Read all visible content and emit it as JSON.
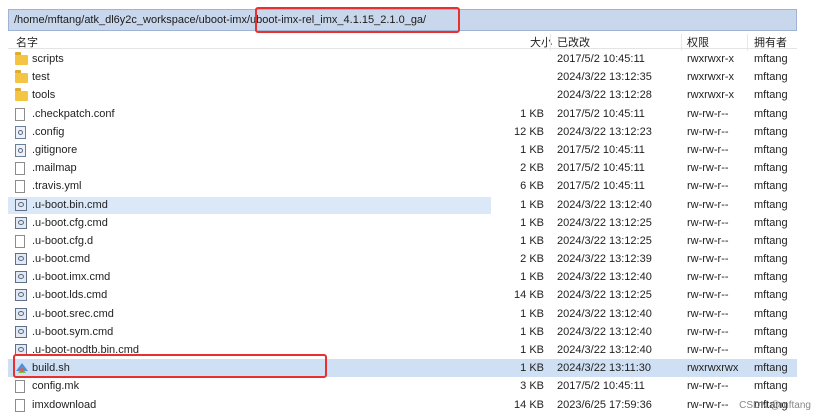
{
  "path": "/home/mftang/atk_dl6y2c_workspace/uboot-imx/uboot-imx-rel_imx_4.1.15_2.1.0_ga/",
  "columns": {
    "name": "名字",
    "size": "大小",
    "date": "已改改",
    "perm": "权限",
    "owner": "拥有者"
  },
  "rows": [
    {
      "name": "scripts",
      "size": "",
      "date": "2017/5/2 10:45:11",
      "perm": "rwxrwxr-x",
      "owner": "mftang",
      "icon": "folder-icon"
    },
    {
      "name": "test",
      "size": "",
      "date": "2024/3/22 13:12:35",
      "perm": "rwxrwxr-x",
      "owner": "mftang",
      "icon": "folder-icon"
    },
    {
      "name": "tools",
      "size": "",
      "date": "2024/3/22 13:12:28",
      "perm": "rwxrwxr-x",
      "owner": "mftang",
      "icon": "folder-icon"
    },
    {
      "name": ".checkpatch.conf",
      "size": "1 KB",
      "date": "2017/5/2 10:45:11",
      "perm": "rw-rw-r--",
      "owner": "mftang",
      "icon": "file-icon"
    },
    {
      "name": ".config",
      "size": "12 KB",
      "date": "2024/3/22 13:12:23",
      "perm": "rw-rw-r--",
      "owner": "mftang",
      "icon": "config-file-icon"
    },
    {
      "name": ".gitignore",
      "size": "1 KB",
      "date": "2017/5/2 10:45:11",
      "perm": "rw-rw-r--",
      "owner": "mftang",
      "icon": "config-file-icon"
    },
    {
      "name": ".mailmap",
      "size": "2 KB",
      "date": "2017/5/2 10:45:11",
      "perm": "rw-rw-r--",
      "owner": "mftang",
      "icon": "file-icon"
    },
    {
      "name": ".travis.yml",
      "size": "6 KB",
      "date": "2017/5/2 10:45:11",
      "perm": "rw-rw-r--",
      "owner": "mftang",
      "icon": "yml-file-icon"
    },
    {
      "name": ".u-boot.bin.cmd",
      "size": "1 KB",
      "date": "2024/3/22 13:12:40",
      "perm": "rw-rw-r--",
      "owner": "mftang",
      "icon": "cmd-file-icon",
      "highlight": "blue"
    },
    {
      "name": ".u-boot.cfg.cmd",
      "size": "1 KB",
      "date": "2024/3/22 13:12:25",
      "perm": "rw-rw-r--",
      "owner": "mftang",
      "icon": "cmd-file-icon"
    },
    {
      "name": ".u-boot.cfg.d",
      "size": "1 KB",
      "date": "2024/3/22 13:12:25",
      "perm": "rw-rw-r--",
      "owner": "mftang",
      "icon": "file-icon"
    },
    {
      "name": ".u-boot.cmd",
      "size": "2 KB",
      "date": "2024/3/22 13:12:39",
      "perm": "rw-rw-r--",
      "owner": "mftang",
      "icon": "cmd-file-icon"
    },
    {
      "name": ".u-boot.imx.cmd",
      "size": "1 KB",
      "date": "2024/3/22 13:12:40",
      "perm": "rw-rw-r--",
      "owner": "mftang",
      "icon": "cmd-file-icon"
    },
    {
      "name": ".u-boot.lds.cmd",
      "size": "14 KB",
      "date": "2024/3/22 13:12:25",
      "perm": "rw-rw-r--",
      "owner": "mftang",
      "icon": "cmd-file-icon"
    },
    {
      "name": ".u-boot.srec.cmd",
      "size": "1 KB",
      "date": "2024/3/22 13:12:40",
      "perm": "rw-rw-r--",
      "owner": "mftang",
      "icon": "cmd-file-icon"
    },
    {
      "name": ".u-boot.sym.cmd",
      "size": "1 KB",
      "date": "2024/3/22 13:12:40",
      "perm": "rw-rw-r--",
      "owner": "mftang",
      "icon": "cmd-file-icon"
    },
    {
      "name": ".u-boot-nodtb.bin.cmd",
      "size": "1 KB",
      "date": "2024/3/22 13:12:40",
      "perm": "rw-rw-r--",
      "owner": "mftang",
      "icon": "cmd-file-icon"
    },
    {
      "name": "build.sh",
      "size": "1 KB",
      "date": "2024/3/22 13:11:30",
      "perm": "rwxrwxrwx",
      "owner": "mftang",
      "icon": "shell-script-icon",
      "highlight": "strong"
    },
    {
      "name": "config.mk",
      "size": "3 KB",
      "date": "2017/5/2 10:45:11",
      "perm": "rw-rw-r--",
      "owner": "mftang",
      "icon": "file-icon"
    },
    {
      "name": "imxdownload",
      "size": "14 KB",
      "date": "2023/6/25 17:59:36",
      "perm": "rw-rw-r--",
      "owner": "mftang",
      "icon": "file-icon"
    }
  ],
  "watermark": "CSDN @mftang",
  "colors": {
    "annotation": "#e8312f",
    "path_bar": "#c9d7ec",
    "selected_row": "#cfe0f5"
  }
}
